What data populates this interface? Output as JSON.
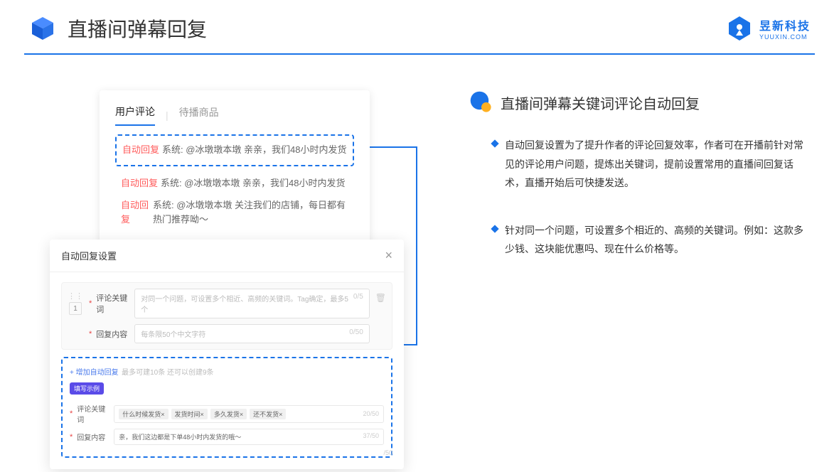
{
  "header": {
    "title": "直播间弹幕回复",
    "brand_name": "昱新科技",
    "brand_url": "YUUXIN.COM"
  },
  "comments": {
    "tab_active": "用户评论",
    "tab_inactive": "待播商品",
    "row1_tag": "自动回复",
    "row1_text": "系统: @冰墩墩本墩 亲亲，我们48小时内发货",
    "row2_tag": "自动回复",
    "row2_text": "系统: @冰墩墩本墩 亲亲，我们48小时内发货",
    "row3_tag": "自动回复",
    "row3_text": "系统: @冰墩墩本墩 关注我们的店铺，每日都有热门推荐呦～"
  },
  "modal": {
    "title": "自动回复设置",
    "idx": "1",
    "label_keyword": "评论关键词",
    "label_content": "回复内容",
    "ph_keyword": "对同一个问题，可设置多个相近、高频的关键词。Tag确定，最多5个",
    "cnt_keyword": "0/5",
    "ph_content": "每条限50个中文字符",
    "cnt_content": "0/50",
    "add_link": "+ 增加自动回复",
    "add_hint": "最多可建10条 还可以创建9条",
    "ex_badge": "填写示例",
    "ex_kw_label": "评论关键词",
    "ex_p1": "什么时候发货×",
    "ex_p2": "发货时间×",
    "ex_p3": "多久发货×",
    "ex_p4": "还不发货×",
    "ex_kw_cnt": "20/50",
    "ex_ct_label": "回复内容",
    "ex_ct_text": "亲，我们这边都是下单48小时内发货的哦～",
    "ex_ct_cnt": "37/50",
    "bottom_cnt": "/50"
  },
  "section": {
    "title": "直播间弹幕关键词评论自动回复",
    "b1": "自动回复设置为了提升作者的评论回复效率，作者可在开播前针对常见的评论用户问题，提炼出关键词，提前设置常用的直播间回复话术，直播开始后可快捷发送。",
    "b2": "针对同一个问题，可设置多个相近的、高频的关键词。例如：这款多少钱、这块能优惠吗、现在什么价格等。"
  }
}
